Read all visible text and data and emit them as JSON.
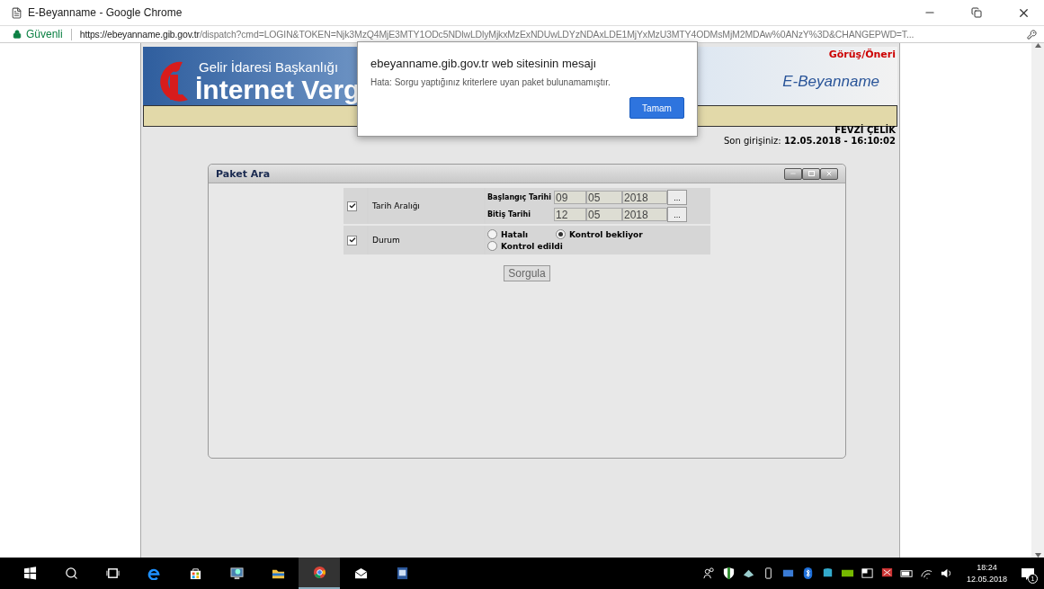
{
  "browser": {
    "title": "E-Beyanname - Google Chrome",
    "security": "Güvenli",
    "url_domain": "https://ebeyanname.gib.gov.tr",
    "url_path": "/dispatch?cmd=LOGIN&TOKEN=Njk3MzQ4MjE3MTY1ODc5NDlwLDlyMjkxMzExNDUwLDYzNDAxLDE1MjYxMzU3MTY4ODMsMjM2MDAw%0ANzY%3D&CHANGEPWD=T..."
  },
  "header": {
    "org": "Gelir İdaresi Başkanlığı",
    "brand": "İnternet Verg",
    "feedback_link": "Görüş/Öneri",
    "app_name": "E-Beyanname",
    "user": "FEVZİ ÇELİK",
    "last_login_label": "Son girişiniz:",
    "last_login": "12.05.2018 - 16:10:02"
  },
  "panel": {
    "title": "Paket Ara",
    "filters": [
      {
        "kind": "dates",
        "label": "Tarih Aralığı",
        "checked": true,
        "dates": [
          {
            "label": "Başlangıç Tarihi",
            "day": "09",
            "month": "05",
            "year": "2018",
            "button": "..."
          },
          {
            "label": "Bitiş Tarihi",
            "day": "12",
            "month": "05",
            "year": "2018",
            "button": "..."
          }
        ]
      },
      {
        "kind": "status",
        "label": "Durum",
        "checked": true,
        "options": [
          {
            "label": "Hatalı",
            "selected": false
          },
          {
            "label": "Kontrol bekliyor",
            "selected": true
          },
          {
            "label": "Kontrol edildi",
            "selected": false
          }
        ]
      }
    ],
    "submit": "Sorgula"
  },
  "dialog": {
    "title": "ebeyanname.gib.gov.tr web sitesinin mesajı",
    "message": "Hata: Sorgu yaptığınız kriterlere uyan paket bulunamamıştır.",
    "ok": "Tamam"
  },
  "taskbar": {
    "time": "18:24",
    "date": "12.05.2018",
    "notification_count": "1"
  }
}
